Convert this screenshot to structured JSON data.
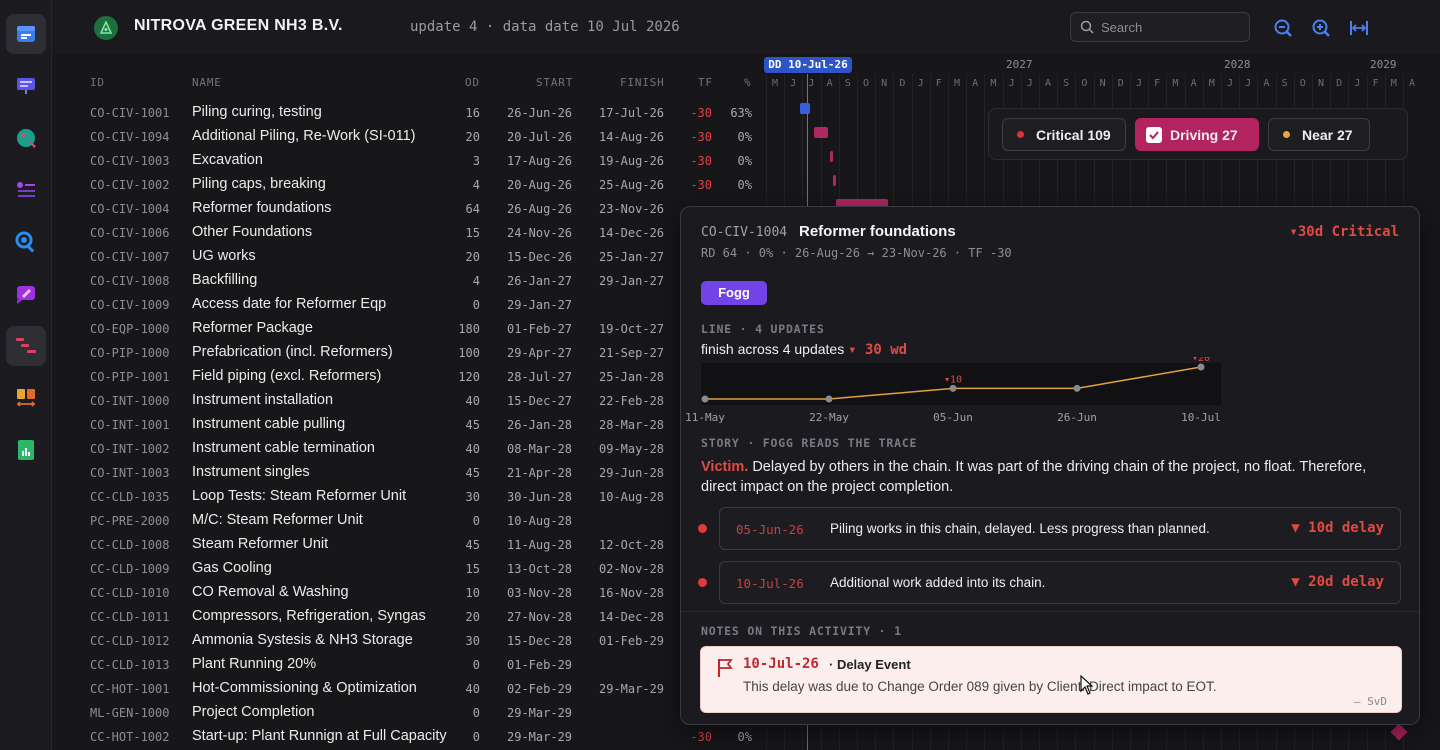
{
  "app": {
    "company": "NITROVA GREEN NH3 B.V.",
    "update_info": "update 4 · data date 10 Jul 2026"
  },
  "search": {
    "placeholder": "Search",
    "value": ""
  },
  "columns": {
    "id": "ID",
    "name": "NAME",
    "od": "OD",
    "start": "START",
    "finish": "FINISH",
    "tf": "TF",
    "pct": "%"
  },
  "timeline": {
    "data_date_badge": "DD 10-Jul-26",
    "years": [
      "2027",
      "2028",
      "2029"
    ],
    "months": [
      "M",
      "J",
      "J",
      "A",
      "S",
      "O",
      "N",
      "D",
      "J",
      "F",
      "M",
      "A",
      "M",
      "J",
      "J",
      "A",
      "S",
      "O",
      "N",
      "D",
      "J",
      "F",
      "M",
      "A",
      "M",
      "J",
      "J",
      "A",
      "S",
      "O",
      "N",
      "D",
      "J",
      "F",
      "M",
      "A"
    ]
  },
  "activities": [
    {
      "id": "CO-CIV-1001",
      "name": "Piling curing, testing",
      "od": "16",
      "start": "26-Jun-26",
      "finish": "17-Jul-26",
      "tf": "-30",
      "pct": "63%"
    },
    {
      "id": "CO-CIV-1094",
      "name": "Additional Piling, Re-Work (SI-011)",
      "od": "20",
      "start": "20-Jul-26",
      "finish": "14-Aug-26",
      "tf": "-30",
      "pct": "0%"
    },
    {
      "id": "CO-CIV-1003",
      "name": "Excavation",
      "od": "3",
      "start": "17-Aug-26",
      "finish": "19-Aug-26",
      "tf": "-30",
      "pct": "0%"
    },
    {
      "id": "CO-CIV-1002",
      "name": "Piling caps, breaking",
      "od": "4",
      "start": "20-Aug-26",
      "finish": "25-Aug-26",
      "tf": "-30",
      "pct": "0%"
    },
    {
      "id": "CO-CIV-1004",
      "name": "Reformer foundations",
      "od": "64",
      "start": "26-Aug-26",
      "finish": "23-Nov-26",
      "tf": "",
      "pct": ""
    },
    {
      "id": "CO-CIV-1006",
      "name": "Other Foundations",
      "od": "15",
      "start": "24-Nov-26",
      "finish": "14-Dec-26",
      "tf": "",
      "pct": ""
    },
    {
      "id": "CO-CIV-1007",
      "name": "UG works",
      "od": "20",
      "start": "15-Dec-26",
      "finish": "25-Jan-27",
      "tf": "",
      "pct": ""
    },
    {
      "id": "CO-CIV-1008",
      "name": "Backfilling",
      "od": "4",
      "start": "26-Jan-27",
      "finish": "29-Jan-27",
      "tf": "",
      "pct": ""
    },
    {
      "id": "CO-CIV-1009",
      "name": "Access date for Reformer Eqp",
      "od": "0",
      "start": "29-Jan-27",
      "finish": "",
      "tf": "",
      "pct": ""
    },
    {
      "id": "CO-EQP-1000",
      "name": "Reformer Package",
      "od": "180",
      "start": "01-Feb-27",
      "finish": "19-Oct-27",
      "tf": "",
      "pct": ""
    },
    {
      "id": "CO-PIP-1000",
      "name": "Prefabrication (incl. Reformers)",
      "od": "100",
      "start": "29-Apr-27",
      "finish": "21-Sep-27",
      "tf": "",
      "pct": ""
    },
    {
      "id": "CO-PIP-1001",
      "name": "Field piping (excl. Reformers)",
      "od": "120",
      "start": "28-Jul-27",
      "finish": "25-Jan-28",
      "tf": "",
      "pct": ""
    },
    {
      "id": "CO-INT-1000",
      "name": "Instrument installation",
      "od": "40",
      "start": "15-Dec-27",
      "finish": "22-Feb-28",
      "tf": "",
      "pct": ""
    },
    {
      "id": "CO-INT-1001",
      "name": "Instrument cable pulling",
      "od": "45",
      "start": "26-Jan-28",
      "finish": "28-Mar-28",
      "tf": "",
      "pct": ""
    },
    {
      "id": "CO-INT-1002",
      "name": "Instrument cable termination",
      "od": "40",
      "start": "08-Mar-28",
      "finish": "09-May-28",
      "tf": "",
      "pct": ""
    },
    {
      "id": "CO-INT-1003",
      "name": "Instrument singles",
      "od": "45",
      "start": "21-Apr-28",
      "finish": "29-Jun-28",
      "tf": "",
      "pct": ""
    },
    {
      "id": "CC-CLD-1035",
      "name": "Loop Tests: Steam Reformer Unit",
      "od": "30",
      "start": "30-Jun-28",
      "finish": "10-Aug-28",
      "tf": "",
      "pct": ""
    },
    {
      "id": "PC-PRE-2000",
      "name": "M/C: Steam Reformer Unit",
      "od": "0",
      "start": "10-Aug-28",
      "finish": "",
      "tf": "",
      "pct": ""
    },
    {
      "id": "CC-CLD-1008",
      "name": "Steam Reformer Unit",
      "od": "45",
      "start": "11-Aug-28",
      "finish": "12-Oct-28",
      "tf": "",
      "pct": ""
    },
    {
      "id": "CC-CLD-1009",
      "name": "Gas Cooling",
      "od": "15",
      "start": "13-Oct-28",
      "finish": "02-Nov-28",
      "tf": "",
      "pct": ""
    },
    {
      "id": "CC-CLD-1010",
      "name": "CO Removal & Washing",
      "od": "10",
      "start": "03-Nov-28",
      "finish": "16-Nov-28",
      "tf": "",
      "pct": ""
    },
    {
      "id": "CC-CLD-1011",
      "name": "Compressors, Refrigeration, Syngas",
      "od": "20",
      "start": "27-Nov-28",
      "finish": "14-Dec-28",
      "tf": "",
      "pct": ""
    },
    {
      "id": "CC-CLD-1012",
      "name": "Ammonia Systesis & NH3 Storage",
      "od": "30",
      "start": "15-Dec-28",
      "finish": "01-Feb-29",
      "tf": "",
      "pct": ""
    },
    {
      "id": "CC-CLD-1013",
      "name": "Plant Running 20%",
      "od": "0",
      "start": "01-Feb-29",
      "finish": "",
      "tf": "",
      "pct": ""
    },
    {
      "id": "CC-HOT-1001",
      "name": "Hot-Commissioning & Optimization",
      "od": "40",
      "start": "02-Feb-29",
      "finish": "29-Mar-29",
      "tf": "",
      "pct": ""
    },
    {
      "id": "ML-GEN-1000",
      "name": "Project Completion",
      "od": "0",
      "start": "29-Mar-29",
      "finish": "",
      "tf": "",
      "pct": ""
    },
    {
      "id": "CC-HOT-1002",
      "name": "Start-up: Plant Runnign at Full Capacity",
      "od": "0",
      "start": "29-Mar-29",
      "finish": "",
      "tf": "-30",
      "pct": "0%"
    }
  ],
  "filters": {
    "critical": {
      "label": "Critical 109",
      "color": "#e0303a"
    },
    "driving": {
      "label": "Driving 27",
      "color": "#b3235f",
      "checked": true
    },
    "near": {
      "label": "Near 27",
      "color": "#e8a632"
    }
  },
  "detail": {
    "id": "CO-CIV-1004",
    "name": "Reformer foundations",
    "status": "▾30d Critical",
    "summary": "RD 64 · 0% · 26-Aug-26 → 23-Nov-26 · TF -30",
    "badge": "Fogg",
    "line_header": "LINE · 4 UPDATES",
    "finish_text": "finish across 4 updates",
    "finish_delta": "▾ 30 wd",
    "story_header": "STORY · FOGG READS THE TRACE",
    "story_victim": "Victim.",
    "story_text": "Delayed by others in the chain. It was part of the driving chain of the project, no float. Therefore, direct impact on the project completion.",
    "events": [
      {
        "date": "05-Jun-26",
        "text": "Piling works in this chain, delayed. Less progress than planned.",
        "delay": "▼ 10d delay"
      },
      {
        "date": "10-Jul-26",
        "text": "Additional work added into its chain.",
        "delay": "▼ 20d delay"
      }
    ],
    "notes_header": "NOTES ON THIS ACTIVITY · 1",
    "note": {
      "date": "10-Jul-26",
      "title": "· Delay Event",
      "body": "This delay was due to Change Order 089 given by Client. Direct impact to EOT.",
      "author": "— SvD"
    }
  },
  "chart_data": {
    "type": "line",
    "x": [
      "11-May",
      "22-May",
      "05-Jun",
      "26-Jun",
      "10-Jul"
    ],
    "values": [
      0,
      0,
      10,
      10,
      30
    ],
    "annotations": [
      {
        "x": "05-Jun",
        "label": "▾10"
      },
      {
        "x": "10-Jul",
        "label": "▾20"
      }
    ]
  },
  "colors": {
    "accent": "#2d54c8",
    "critical": "#e04a44",
    "driving": "#b3235f",
    "badge": "#7244e8"
  }
}
